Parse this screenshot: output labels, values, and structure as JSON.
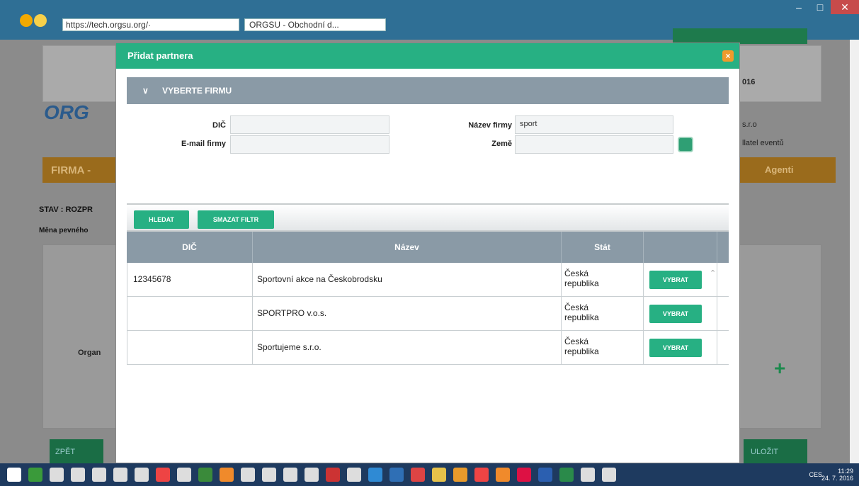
{
  "browser": {
    "address": "https://tech.orgsu.org/·",
    "tab_title": "ORGSU - Obchodní d..."
  },
  "background": {
    "year": "016",
    "company_suffix": "s.r.o",
    "events_label": "llatel eventů",
    "logo_text": "ORG",
    "firma_tab": "FIRMA -",
    "agenti_tab": "Agenti",
    "stav": "STAV : ROZPR",
    "mena": "Měna pevného",
    "organ": "Organ",
    "zpet": "ZPĚT",
    "ulozit": "ULOŽIT"
  },
  "modal": {
    "title": "Přidat partnera",
    "section_title": "VYBERTE FIRMU",
    "form": {
      "dic_label": "DIČ",
      "email_label": "E-mail firmy",
      "nazev_label": "Název firmy",
      "zeme_label": "Země",
      "dic_value": "",
      "email_value": "",
      "nazev_value": "sport",
      "zeme_value": ""
    },
    "buttons": {
      "hledat": "HLEDAT",
      "smazat": "SMAZAT FILTR"
    },
    "table": {
      "headers": [
        "DIČ",
        "Název",
        "Stát"
      ],
      "rows": [
        {
          "dic": "12345678",
          "nazev": "Sportovní akce na Českobrodsku",
          "stat_line1": "Česká",
          "stat_line2": "republika",
          "action": "VYBRAT"
        },
        {
          "dic": "",
          "nazev": "SPORTPRO v.o.s.",
          "stat_line1": "Česká",
          "stat_line2": "republika",
          "action": "VYBRAT"
        },
        {
          "dic": "",
          "nazev": "Sportujeme s.r.o.",
          "stat_line1": "Česká",
          "stat_line2": "republika",
          "action": "VYBRAT"
        }
      ]
    }
  },
  "taskbar": {
    "time": "11:29",
    "date": "24. 7. 2016",
    "lang": "CES"
  }
}
